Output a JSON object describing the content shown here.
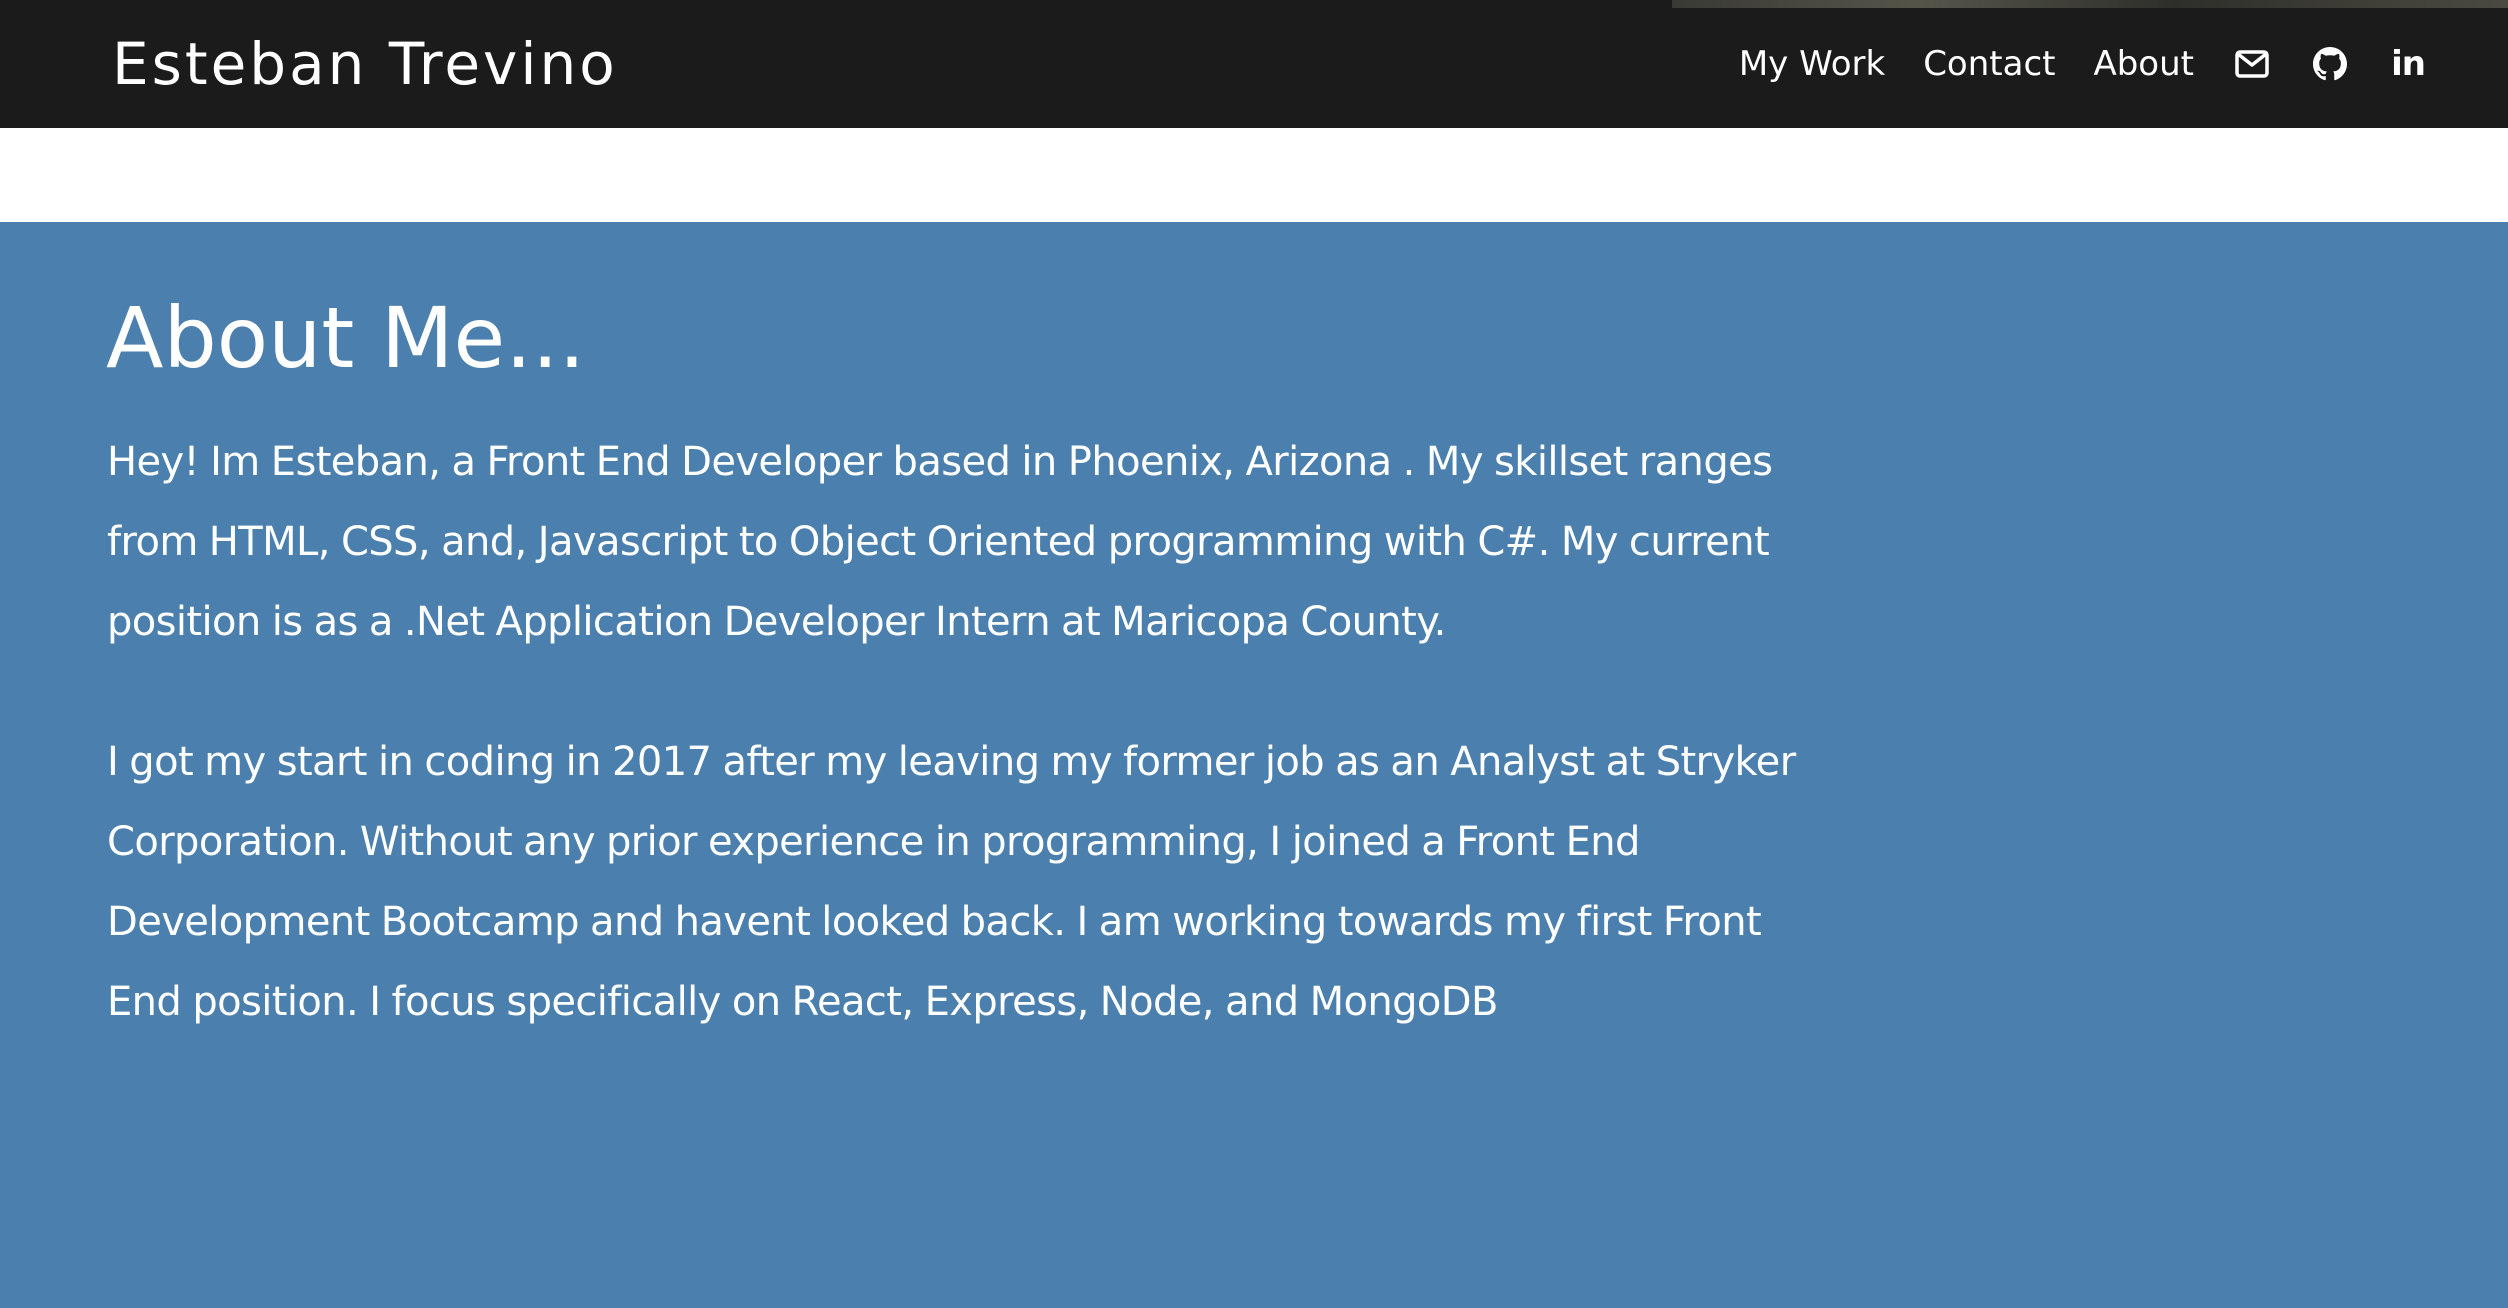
{
  "header": {
    "brand": "Esteban Trevino",
    "nav": [
      {
        "label": "My Work"
      },
      {
        "label": "Contact"
      },
      {
        "label": "About"
      }
    ],
    "icons": [
      "envelope-icon",
      "github-icon",
      "linkedin-icon"
    ],
    "linkedin_glyph": "in"
  },
  "about": {
    "title": "About Me...",
    "paragraphs": [
      "Hey! Im Esteban, a Front End Developer based in Phoenix, Arizona . My skillset ranges from HTML, CSS, and, Javascript to Object Oriented programming with C#. My current position is as a .Net Application Developer Intern at Maricopa County.",
      "I got my start in coding in 2017 after my leaving my former job as an Analyst at Stryker Corporation. Without any prior experience in programming, I joined a Front End Development Bootcamp and havent looked back. I am working towards my first Front End position. I focus specifically on React, Express, Node, and MongoDB"
    ]
  },
  "colors": {
    "navbar_bg": "#1b1b1b",
    "about_bg": "#4a7fae",
    "text": "#ffffff"
  }
}
